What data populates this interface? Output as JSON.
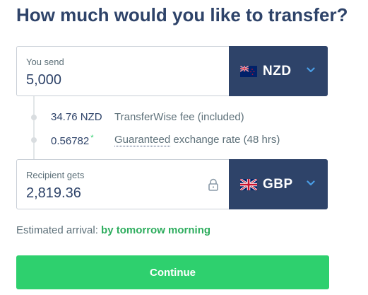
{
  "title": "How much would you like to transfer?",
  "send": {
    "label": "You send",
    "value": "5,000",
    "currency": "NZD",
    "flag_icon": "nz-flag-icon"
  },
  "fee": {
    "amount": "34.76 NZD",
    "label": "TransferWise fee (included)"
  },
  "rate": {
    "value": "0.56782",
    "marker": "*",
    "label_guaranteed": "Guaranteed",
    "label_rest": "exchange rate (48 hrs)"
  },
  "receive": {
    "label": "Recipient gets",
    "value": "2,819.36",
    "currency": "GBP",
    "flag_icon": "uk-flag-icon"
  },
  "arrival": {
    "prefix": "Estimated arrival:",
    "value": "by tomorrow morning"
  },
  "continue_label": "Continue",
  "colors": {
    "navy": "#2e4369",
    "green": "#2ed06e",
    "border": "#c9cfd7"
  }
}
